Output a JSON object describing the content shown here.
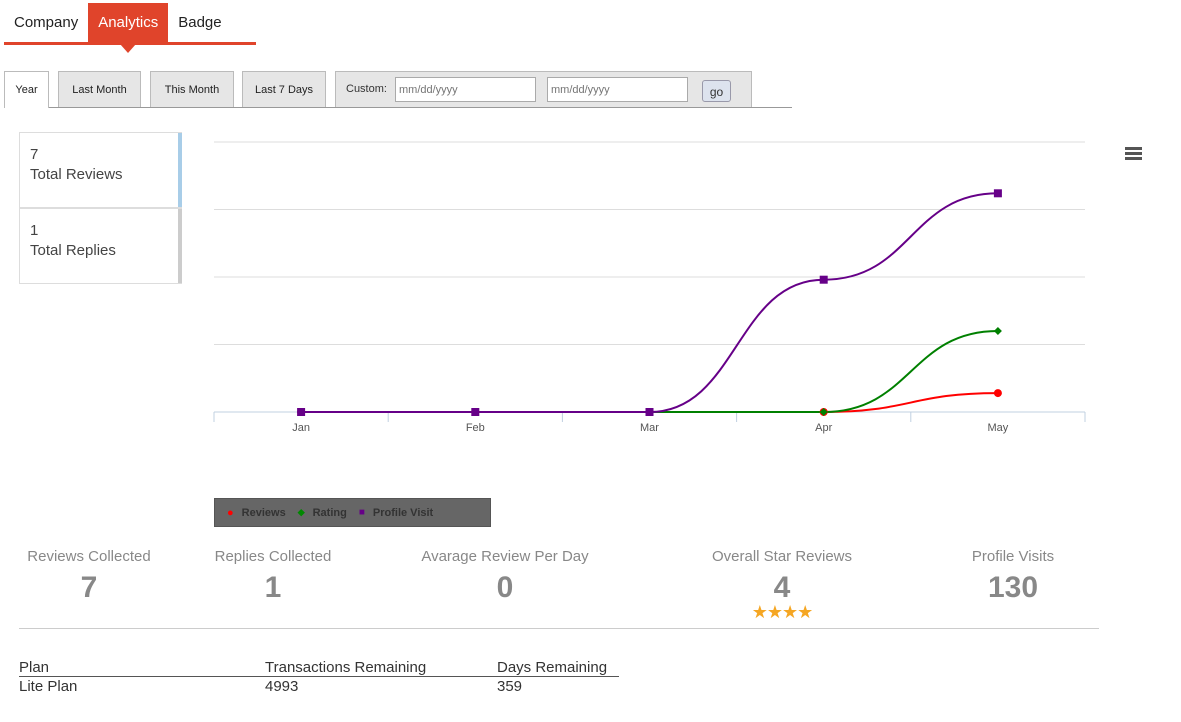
{
  "tabs": [
    {
      "label": "Company"
    },
    {
      "label": "Analytics"
    },
    {
      "label": "Badge"
    }
  ],
  "filters": {
    "year": "Year",
    "last_month": "Last Month",
    "this_month": "This Month",
    "last_7_days": "Last 7 Days",
    "custom_label": "Custom:",
    "from_placeholder": "mm/dd/yyyy",
    "to_placeholder": "mm/dd/yyyy",
    "go": "go"
  },
  "stats": [
    {
      "value": "7",
      "label": "Total Reviews",
      "color": "#a8cde8"
    },
    {
      "value": "1",
      "label": "Total Replies",
      "color": "#cccccc"
    }
  ],
  "chart_data": {
    "type": "line",
    "categories": [
      "Jan",
      "Feb",
      "Mar",
      "Apr",
      "May"
    ],
    "ylim": [
      0,
      100
    ],
    "grid": true,
    "legend_position": "bottom-left",
    "series": [
      {
        "name": "Reviews",
        "color": "#ff0000",
        "marker": "circle",
        "values": [
          0,
          0,
          0,
          0,
          7
        ]
      },
      {
        "name": "Rating",
        "color": "#008000",
        "marker": "diamond",
        "values": [
          0,
          0,
          0,
          0,
          30
        ]
      },
      {
        "name": "Profile Visit",
        "color": "#660088",
        "marker": "square",
        "values": [
          0,
          0,
          0,
          49,
          81
        ]
      }
    ]
  },
  "summary": [
    {
      "label": "Reviews Collected",
      "value": "7"
    },
    {
      "label": "Replies Collected",
      "value": "1"
    },
    {
      "label": "Avarage Review Per Day",
      "value": "0"
    },
    {
      "label": "Overall Star Reviews",
      "value": "4",
      "stars": "★★★★"
    },
    {
      "label": "Profile Visits",
      "value": "130"
    }
  ],
  "plan": {
    "headers": [
      "Plan",
      "Transactions Remaining",
      "Days Remaining"
    ],
    "values": [
      "Lite Plan",
      "4993",
      "359"
    ]
  }
}
